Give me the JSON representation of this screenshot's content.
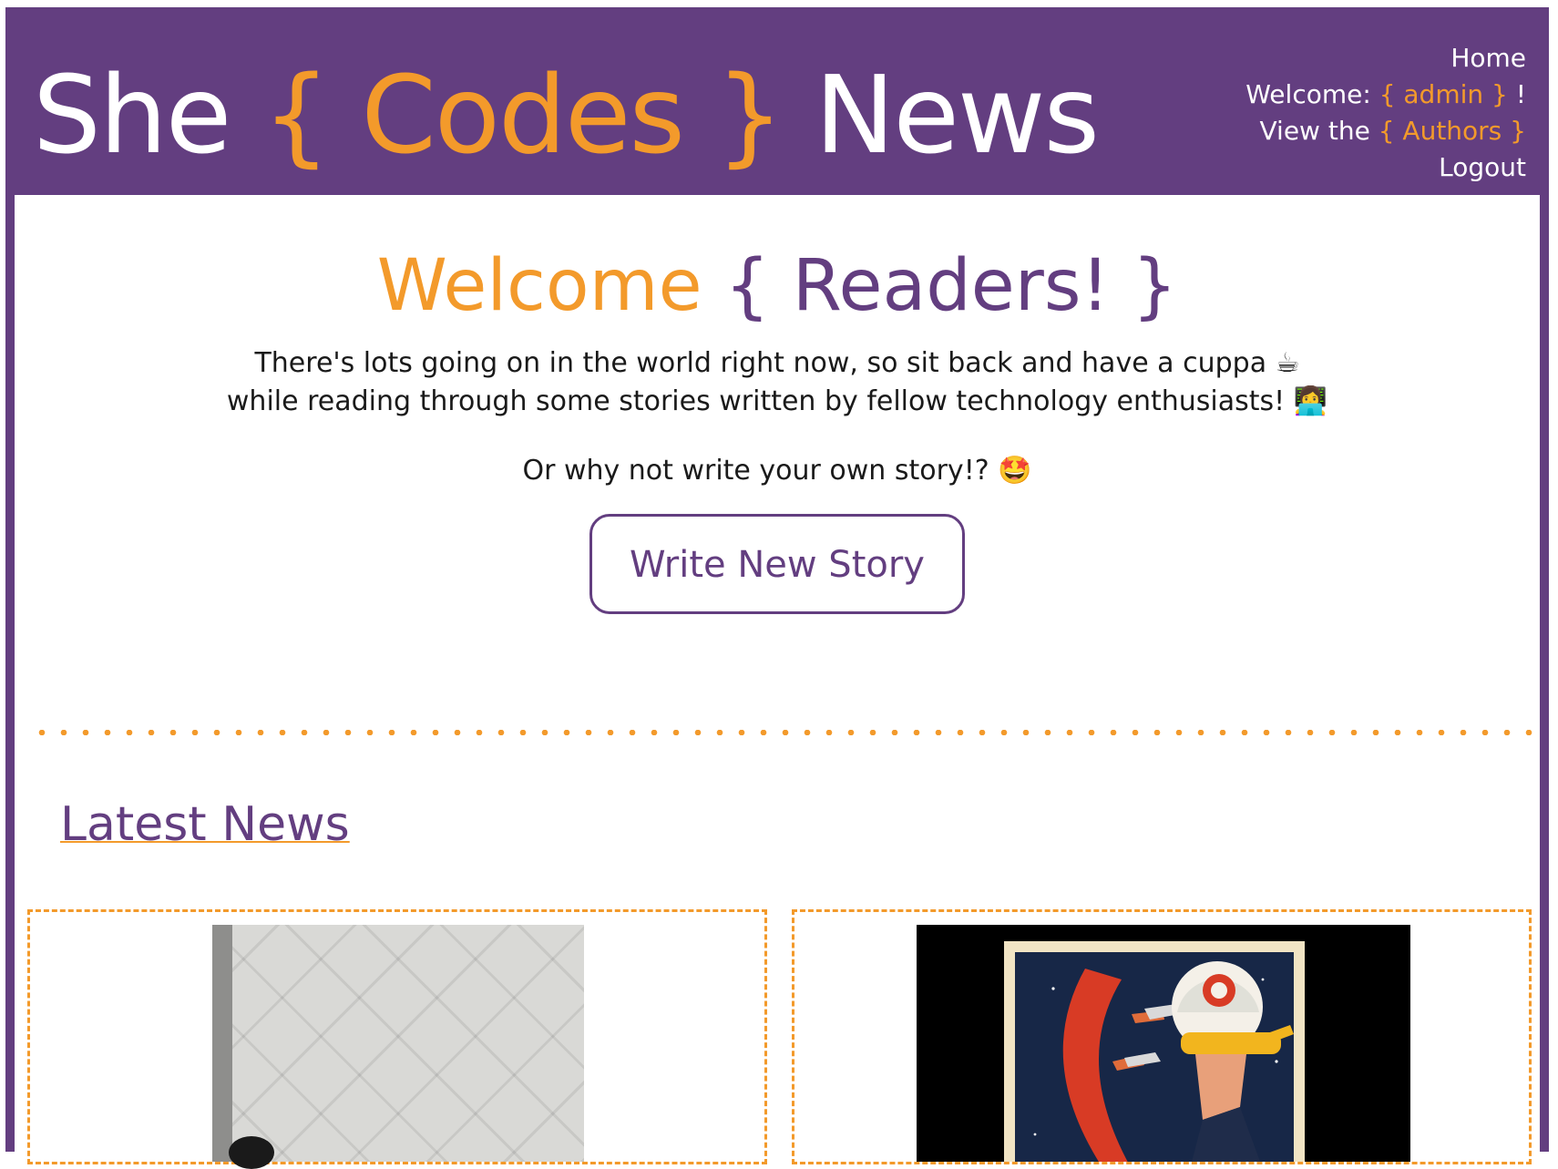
{
  "header": {
    "logo_she": "She",
    "logo_codes": "{ Codes }",
    "logo_news": "News",
    "nav": {
      "home": "Home",
      "welcome_prefix": "Welcome:",
      "welcome_user": "{ admin }",
      "welcome_suffix": "!",
      "view_prefix": "View the",
      "view_link": "{ Authors }",
      "logout": "Logout"
    }
  },
  "hero": {
    "title_welcome": "Welcome",
    "title_readers": "{ Readers! }",
    "intro_line1": "There's lots going on in the world right now, so sit back and have a cuppa ☕",
    "intro_line2": "while reading through some stories written by fellow technology enthusiasts! 👩‍💻",
    "intro_line3": "Or why not write your own story!? 🤩",
    "write_button": "Write New Story"
  },
  "latest": {
    "heading": "Latest News"
  },
  "colors": {
    "purple": "#633e80",
    "orange": "#f39a2b"
  }
}
